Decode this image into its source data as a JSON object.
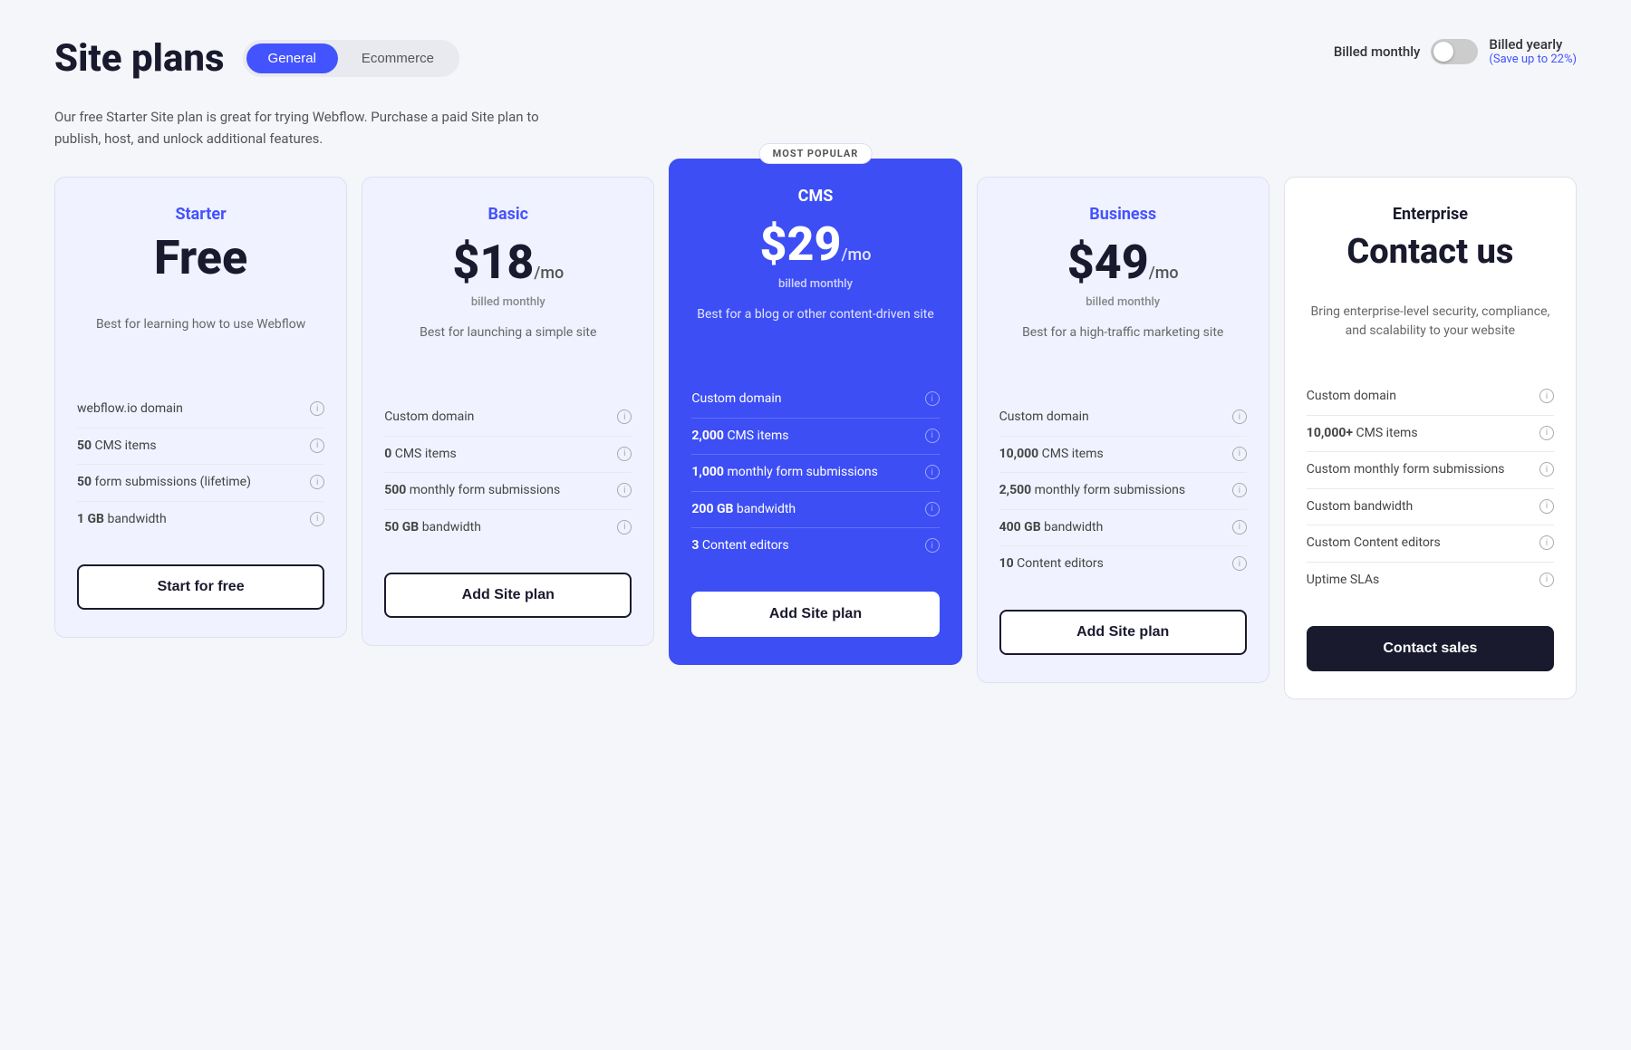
{
  "header": {
    "title": "Site plans",
    "tabs": [
      {
        "label": "General",
        "active": true
      },
      {
        "label": "Ecommerce",
        "active": false
      }
    ]
  },
  "subtitle": "Our free Starter Site plan is great for trying Webflow. Purchase a paid Site plan to publish, host, and unlock additional features.",
  "billing": {
    "monthly_label": "Billed monthly",
    "yearly_label": "Billed yearly",
    "save_label": "(Save up to 22%)"
  },
  "plans": [
    {
      "id": "starter",
      "name": "Starter",
      "price": "Free",
      "price_type": "free",
      "billed": "",
      "desc": "Best for learning how to use Webflow",
      "features": [
        {
          "text": "webflow.io domain",
          "highlight": ""
        },
        {
          "text": "50 CMS items",
          "highlight": "50"
        },
        {
          "text": "50 form submissions (lifetime)",
          "highlight": "50"
        },
        {
          "text": "1 GB bandwidth",
          "highlight": "1 GB"
        }
      ],
      "btn_label": "Start for free",
      "btn_type": "default"
    },
    {
      "id": "basic",
      "name": "Basic",
      "price": "$18",
      "price_type": "monthly",
      "billed": "billed monthly",
      "desc": "Best for launching a simple site",
      "features": [
        {
          "text": "Custom domain",
          "highlight": ""
        },
        {
          "text": "0 CMS items",
          "highlight": "0"
        },
        {
          "text": "500 monthly form submissions",
          "highlight": "500"
        },
        {
          "text": "50 GB bandwidth",
          "highlight": "50 GB"
        }
      ],
      "btn_label": "Add Site plan",
      "btn_type": "default"
    },
    {
      "id": "cms",
      "name": "CMS",
      "price": "$29",
      "price_type": "monthly",
      "billed": "billed monthly",
      "desc": "Best for a blog or other content-driven site",
      "badge": "MOST POPULAR",
      "features": [
        {
          "text": "Custom domain",
          "highlight": ""
        },
        {
          "text": "2,000 CMS items",
          "highlight": "2,000"
        },
        {
          "text": "1,000 monthly form submissions",
          "highlight": "1,000"
        },
        {
          "text": "200 GB bandwidth",
          "highlight": "200 GB"
        },
        {
          "text": "3 Content editors",
          "highlight": "3"
        }
      ],
      "btn_label": "Add Site plan",
      "btn_type": "cms"
    },
    {
      "id": "business",
      "name": "Business",
      "price": "$49",
      "price_type": "monthly",
      "billed": "billed monthly",
      "desc": "Best for a high-traffic marketing site",
      "features": [
        {
          "text": "Custom domain",
          "highlight": ""
        },
        {
          "text": "10,000 CMS items",
          "highlight": "10,000"
        },
        {
          "text": "2,500 monthly form submissions",
          "highlight": "2,500"
        },
        {
          "text": "400 GB bandwidth",
          "highlight": "400 GB"
        },
        {
          "text": "10 Content editors",
          "highlight": "10"
        }
      ],
      "btn_label": "Add Site plan",
      "btn_type": "default"
    },
    {
      "id": "enterprise",
      "name": "Enterprise",
      "price": "Contact us",
      "price_type": "contact",
      "billed": "",
      "desc": "Bring enterprise-level security, compliance, and scalability to your website",
      "features": [
        {
          "text": "Custom domain",
          "highlight": ""
        },
        {
          "text": "10,000+ CMS items",
          "highlight": "10,000+"
        },
        {
          "text": "Custom monthly form submissions",
          "highlight": "Custom"
        },
        {
          "text": "Custom bandwidth",
          "highlight": "Custom"
        },
        {
          "text": "Custom Content editors",
          "highlight": "Custom"
        },
        {
          "text": "Uptime SLAs",
          "highlight": ""
        }
      ],
      "btn_label": "Contact sales",
      "btn_type": "enterprise"
    }
  ],
  "icons": {
    "info": "i"
  }
}
